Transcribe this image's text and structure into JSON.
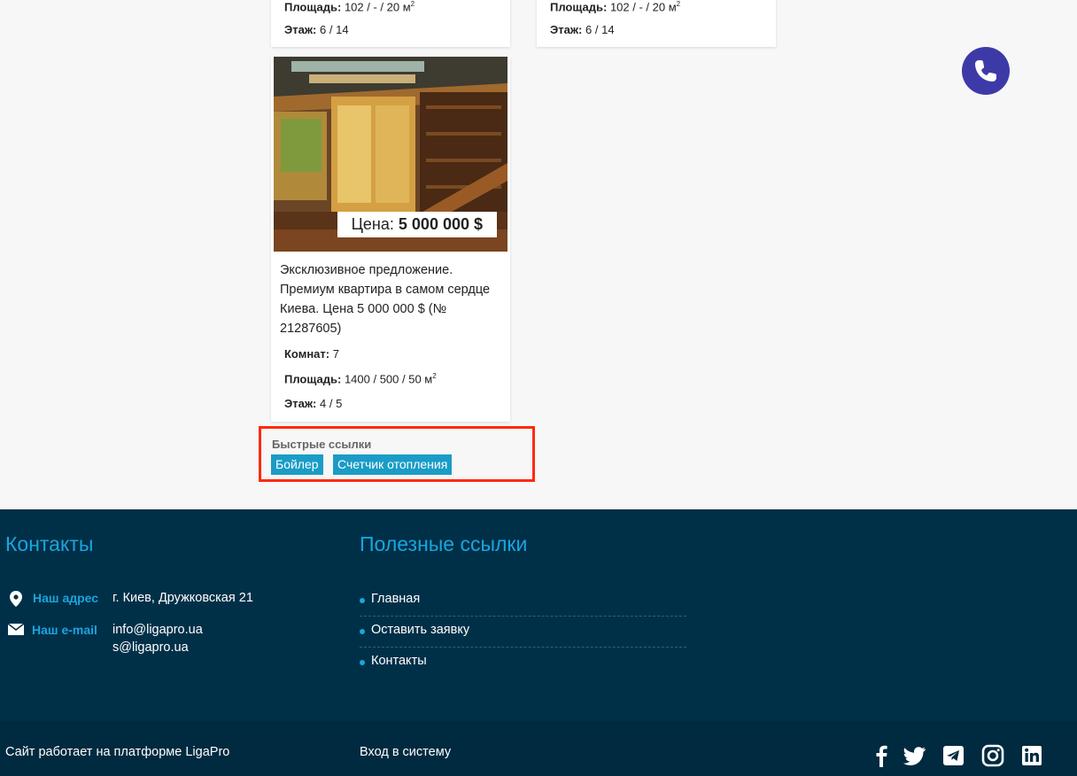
{
  "listings_top": [
    {
      "area_label": "Площадь:",
      "area_value": "102 / - / 20 м",
      "area_unit_sup": "2",
      "floor_label": "Этаж:",
      "floor_value": "6 / 14"
    },
    {
      "area_label": "Площадь:",
      "area_value": "102 / - / 20 м",
      "area_unit_sup": "2",
      "floor_label": "Этаж:",
      "floor_value": "6 / 14"
    }
  ],
  "listing_main": {
    "price_label": "Цена:",
    "price_value": "5 000 000 $",
    "description": "Эксклюзивное предложение. Премиум квартира в самом сердце Киева. Цена 5 000 000 $  (№ 21287605)",
    "rooms_label": "Комнат:",
    "rooms_value": "7",
    "area_label": "Площадь:",
    "area_value": "1400 / 500 / 50 м",
    "area_unit_sup": "2",
    "floor_label": "Этаж:",
    "floor_value": "4 / 5"
  },
  "quick_links": {
    "title": "Быстрые ссылки",
    "items": [
      "Бойлер",
      "Счетчик отопления"
    ]
  },
  "footer": {
    "contacts_title": "Контакты",
    "address_label": "Наш адрес",
    "address_value": "г. Киев, Дружковская 21",
    "email_label": "Наш e-mail",
    "emails": [
      "info@ligapro.ua",
      "s@ligapro.ua"
    ],
    "links_title": "Полезные ссылки",
    "links": [
      "Главная",
      "Оставить заявку",
      "Контакты"
    ],
    "platform_text": "Сайт работает на платформе LigaPro",
    "login_text": "Вход в систему",
    "social_icons": [
      "facebook-icon",
      "twitter-icon",
      "telegram-icon",
      "instagram-icon",
      "linkedin-icon"
    ]
  },
  "colors": {
    "accent": "#1aa5de",
    "tag_bg": "#1a9cc6",
    "footer_bg": "#003048",
    "highlight_border": "#ff2a0a",
    "phone_button": "#3d3aa8"
  }
}
